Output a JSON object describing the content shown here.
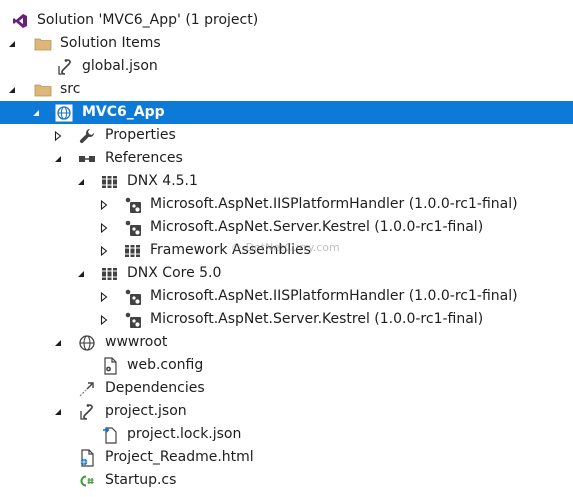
{
  "tree": {
    "solution": {
      "label": "Solution 'MVC6_App' (1 project)"
    },
    "solution_items": {
      "label": "Solution Items"
    },
    "global_json": {
      "label": "global.json"
    },
    "src": {
      "label": "src"
    },
    "project": {
      "label": "MVC6_App",
      "selected": true
    },
    "properties": {
      "label": "Properties"
    },
    "references": {
      "label": "References"
    },
    "dnx451": {
      "label": "DNX 4.5.1"
    },
    "dnx451_iis": {
      "label": "Microsoft.AspNet.IISPlatformHandler (1.0.0-rc1-final)"
    },
    "dnx451_kestrel": {
      "label": "Microsoft.AspNet.Server.Kestrel (1.0.0-rc1-final)"
    },
    "dnx451_framework": {
      "label": "Framework Assemblies"
    },
    "dnxcore50": {
      "label": "DNX Core 5.0"
    },
    "dnxcore_iis": {
      "label": "Microsoft.AspNet.IISPlatformHandler (1.0.0-rc1-final)"
    },
    "dnxcore_kestrel": {
      "label": "Microsoft.AspNet.Server.Kestrel (1.0.0-rc1-final)"
    },
    "wwwroot": {
      "label": "wwwroot"
    },
    "web_config": {
      "label": "web.config"
    },
    "dependencies": {
      "label": "Dependencies"
    },
    "project_json": {
      "label": "project.json"
    },
    "project_lock_json": {
      "label": "project.lock.json"
    },
    "project_readme": {
      "label": "Project_Readme.html"
    },
    "startup_cs": {
      "label": "Startup.cs"
    }
  },
  "watermark": "© DotNetCurry.com",
  "colors": {
    "selection": "#0e7ad8",
    "expander": "#1e1e1e",
    "folder": "#dcb67a",
    "vs_purple": "#68217a",
    "web_blue": "#1a73c9"
  }
}
